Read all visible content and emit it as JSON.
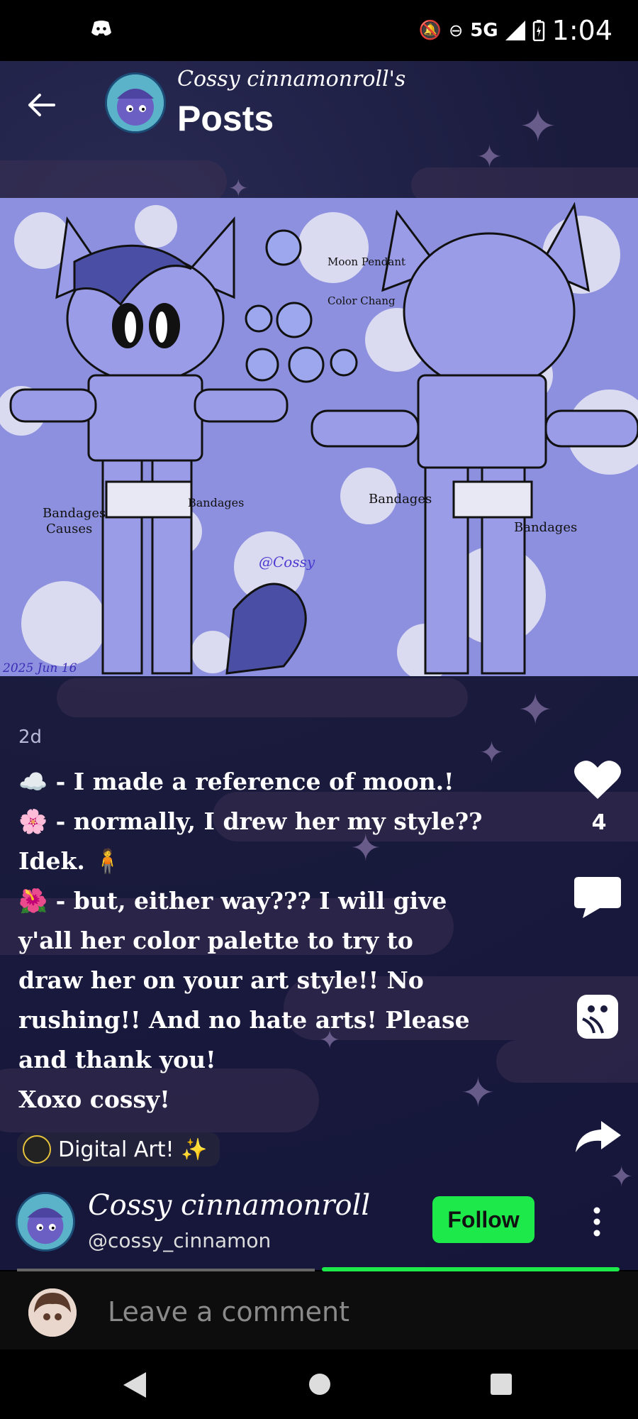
{
  "status_bar": {
    "time": "1:04",
    "network": "5G"
  },
  "header": {
    "subtitle": "Cossy cinnamonroll's",
    "title": "Posts"
  },
  "artwork": {
    "notes": [
      "Moon",
      "Pendant",
      "Color",
      "Chang",
      "Bandages",
      "Causes",
      "@Cossy",
      "2025 Jun 16"
    ]
  },
  "post": {
    "age": "2d",
    "lines": [
      "☁️ - I made a reference of moon.!",
      "🌸 - normally, I drew her my style??",
      "Idek. 🧍",
      "🌺 - but, either way??? I will give",
      "y'all her color palette to try to",
      "draw her on your art style!! No",
      "rushing!! And no hate arts! Please",
      "and thank you!",
      "Xoxo cossy!"
    ],
    "likes": "4",
    "tag": "Digital Art! ✨"
  },
  "author": {
    "name": "Cossy cinnamonroll",
    "handle": "@cossy_cinnamon",
    "follow_label": "Follow"
  },
  "comment": {
    "placeholder": "Leave a comment"
  },
  "colors": {
    "accent": "#1de94a",
    "background": "#1a1b3d",
    "art_bg": "#8f93df"
  }
}
